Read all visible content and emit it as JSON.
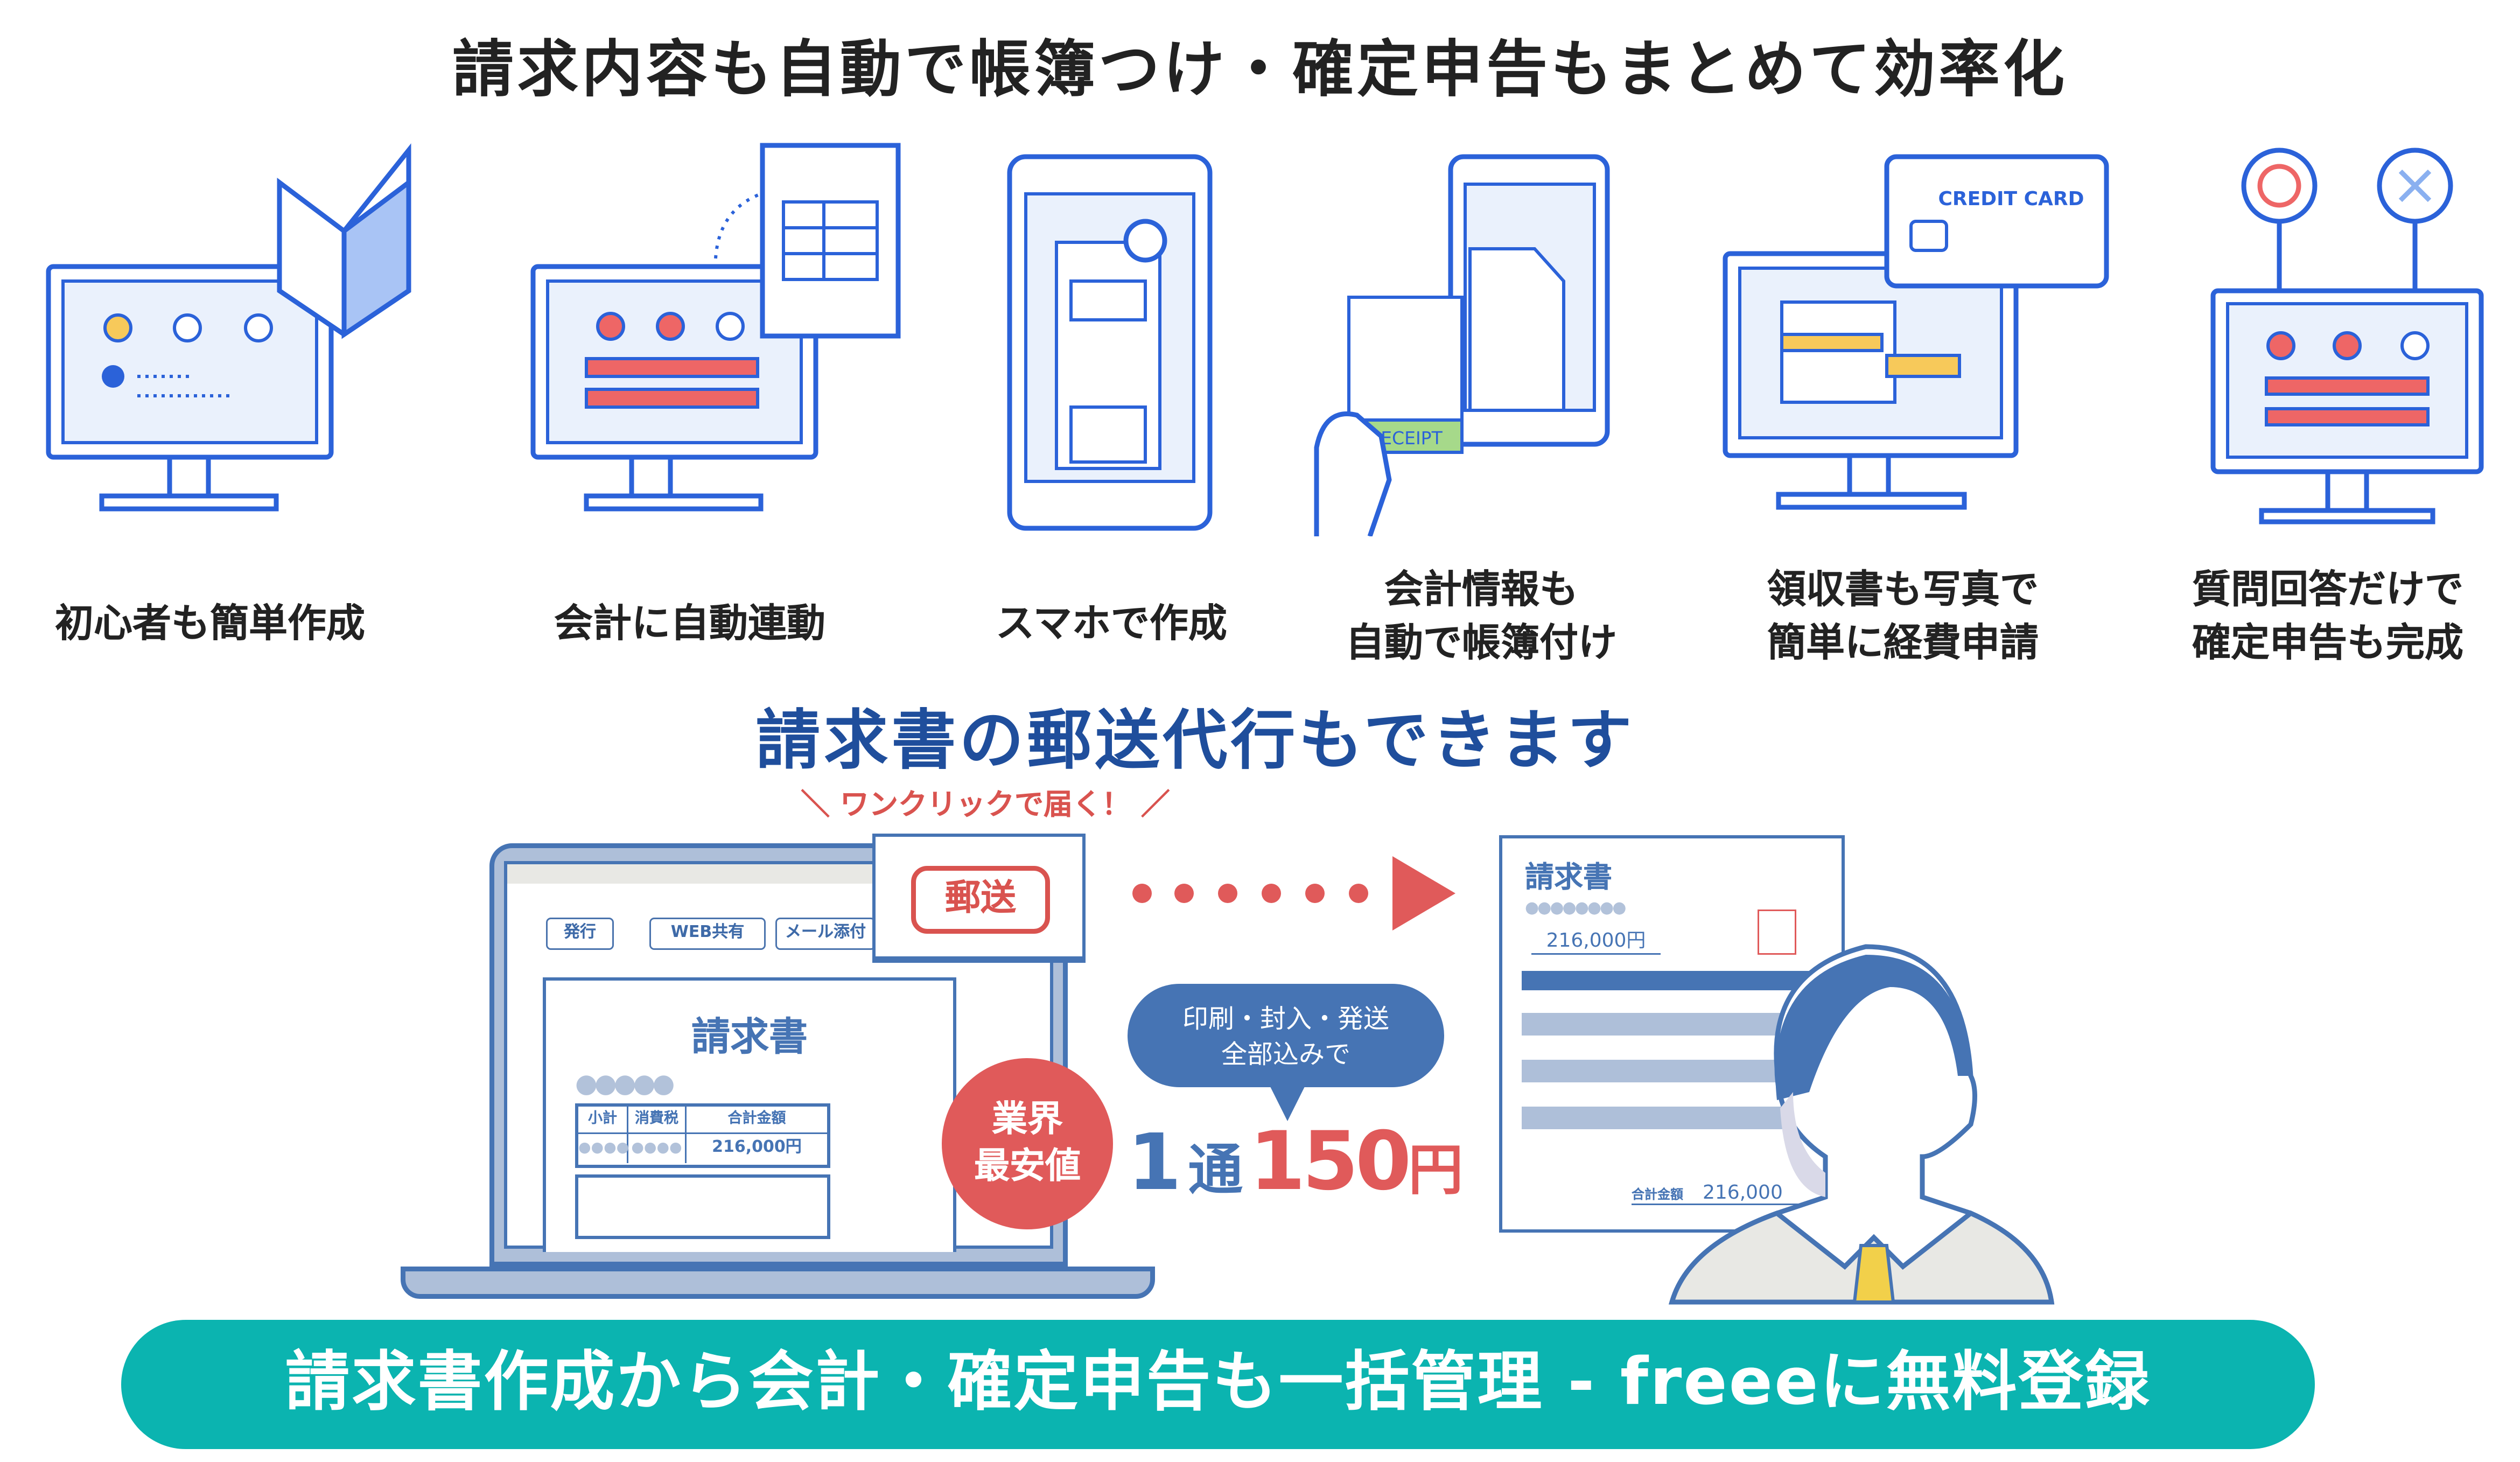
{
  "title": "請求内容も自動で帳簿つけ・確定申告もまとめて効率化",
  "features": [
    {
      "label_lines": [
        "初心者も簡単作成"
      ],
      "icon": "monitor-beginner-mark-icon"
    },
    {
      "label_lines": [
        "会計に自動連動"
      ],
      "icon": "monitor-spreadsheet-icon"
    },
    {
      "label_lines": [
        "スマホで作成"
      ],
      "icon": "smartphone-icon"
    },
    {
      "label_lines": [
        "会計情報も",
        "自動で帳簿付け"
      ],
      "icon": "receipt-phone-icon",
      "illustration_text": "RECEIPT"
    },
    {
      "label_lines": [
        "領収書も写真で",
        "簡単に経費申請"
      ],
      "icon": "credit-card-monitor-icon",
      "illustration_text": "CREDIT CARD"
    },
    {
      "label_lines": [
        "質問回答だけで",
        "確定申告も完成"
      ],
      "icon": "monitor-circle-cross-icon"
    }
  ],
  "mailing": {
    "heading": "請求書の郵送代行もできます",
    "one_click": "＼ ワンクリックで届く！ ／",
    "laptop": {
      "buttons": [
        "発行",
        "WEB共有",
        "メール添付"
      ],
      "mail_button": "郵送",
      "invoice_title": "請求書",
      "table_headers": [
        "小計",
        "消費税",
        "合計金額"
      ],
      "amount": "216,000円"
    },
    "badge": [
      "業界",
      "最安値"
    ],
    "bubble": [
      "印刷・封入・発送",
      "全部込みで"
    ],
    "price": {
      "prefix_num": "1",
      "prefix_unit": "通",
      "amount": "150",
      "currency": "円"
    },
    "received_invoice": {
      "title": "請求書",
      "amount": "216,000円",
      "total_label": "合計金額",
      "total": "216,000"
    }
  },
  "cta": {
    "label": "請求書作成から会計・確定申告も一括管理 - freeeに無料登録"
  },
  "colors": {
    "brand_blue": "#1f4e9c",
    "line_blue": "#2b62d9",
    "accent_red": "#d9534f",
    "cta_teal": "#0bb4b0",
    "illustration_blue": "#4674b4"
  }
}
